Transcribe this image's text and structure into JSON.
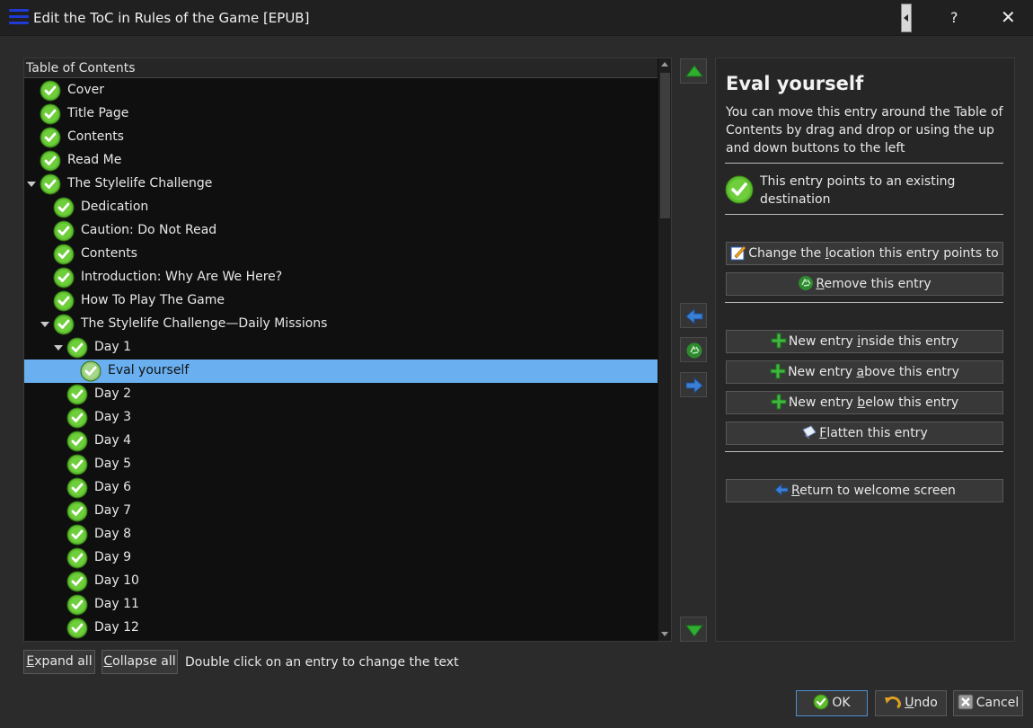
{
  "window": {
    "title": "Edit the ToC in Rules of the Game [EPUB]",
    "help": "?",
    "close": "✕"
  },
  "tree": {
    "header": "Table of Contents",
    "rows": [
      {
        "label": "Cover",
        "level": 0,
        "expanded": null
      },
      {
        "label": "Title Page",
        "level": 0,
        "expanded": null
      },
      {
        "label": "Contents",
        "level": 0,
        "expanded": null
      },
      {
        "label": "Read Me",
        "level": 0,
        "expanded": null
      },
      {
        "label": "The Stylelife Challenge",
        "level": 0,
        "expanded": true
      },
      {
        "label": "Dedication",
        "level": 1,
        "expanded": null
      },
      {
        "label": "Caution: Do Not Read",
        "level": 1,
        "expanded": null
      },
      {
        "label": "Contents",
        "level": 1,
        "expanded": null
      },
      {
        "label": "Introduction: Why Are We Here?",
        "level": 1,
        "expanded": null
      },
      {
        "label": "How To Play The Game",
        "level": 1,
        "expanded": null
      },
      {
        "label": "The Stylelife Challenge—Daily Missions",
        "level": 1,
        "expanded": true
      },
      {
        "label": "Day 1",
        "level": 2,
        "expanded": true
      },
      {
        "label": "Eval yourself",
        "level": 3,
        "expanded": null,
        "selected": true
      },
      {
        "label": "Day 2",
        "level": 2,
        "expanded": null
      },
      {
        "label": "Day 3",
        "level": 2,
        "expanded": null
      },
      {
        "label": "Day 4",
        "level": 2,
        "expanded": null
      },
      {
        "label": "Day 5",
        "level": 2,
        "expanded": null
      },
      {
        "label": "Day 6",
        "level": 2,
        "expanded": null
      },
      {
        "label": "Day 7",
        "level": 2,
        "expanded": null
      },
      {
        "label": "Day 8",
        "level": 2,
        "expanded": null
      },
      {
        "label": "Day 9",
        "level": 2,
        "expanded": null
      },
      {
        "label": "Day 10",
        "level": 2,
        "expanded": null
      },
      {
        "label": "Day 11",
        "level": 2,
        "expanded": null
      },
      {
        "label": "Day 12",
        "level": 2,
        "expanded": null
      }
    ]
  },
  "panel": {
    "title": "Eval yourself",
    "description": "You can move this entry around the Table of Contents by drag and drop or using the up and down buttons to the left",
    "status": "This entry points to an existing destination",
    "buttons": {
      "change_location": {
        "pre": "Change the ",
        "key": "l",
        "post": "ocation this entry points to"
      },
      "remove": {
        "pre": "",
        "key": "R",
        "post": "emove this entry"
      },
      "new_inside": {
        "pre": "New entry ",
        "key": "i",
        "post": "nside this entry"
      },
      "new_above": {
        "pre": "New entry ",
        "key": "a",
        "post": "bove this entry"
      },
      "new_below": {
        "pre": "New entry ",
        "key": "b",
        "post": "elow this entry"
      },
      "flatten": {
        "pre": "",
        "key": "F",
        "post": "latten this entry"
      },
      "return": {
        "pre": "",
        "key": "R",
        "post": "eturn to welcome screen"
      }
    }
  },
  "bottom": {
    "expand_all": {
      "key": "E",
      "post": "xpand all"
    },
    "collapse_all": {
      "key": "C",
      "post": "ollapse all"
    },
    "hint": "Double click on an entry to change the text",
    "ok": "OK",
    "undo": {
      "key": "U",
      "post": "ndo"
    },
    "cancel": "Cancel"
  },
  "colors": {
    "selection": "#6ab0f0",
    "check_green": "#5cbd2c",
    "arrow_green": "#2fae2f",
    "arrow_blue": "#3a7fd6"
  },
  "icons": [
    "menu-icon",
    "check-icon",
    "arrow-up-icon",
    "arrow-down-icon",
    "arrow-left-icon",
    "arrow-right-icon",
    "recycle-icon",
    "edit-icon",
    "plus-icon",
    "flatten-icon",
    "back-arrow-icon",
    "undo-icon",
    "cancel-icon"
  ]
}
